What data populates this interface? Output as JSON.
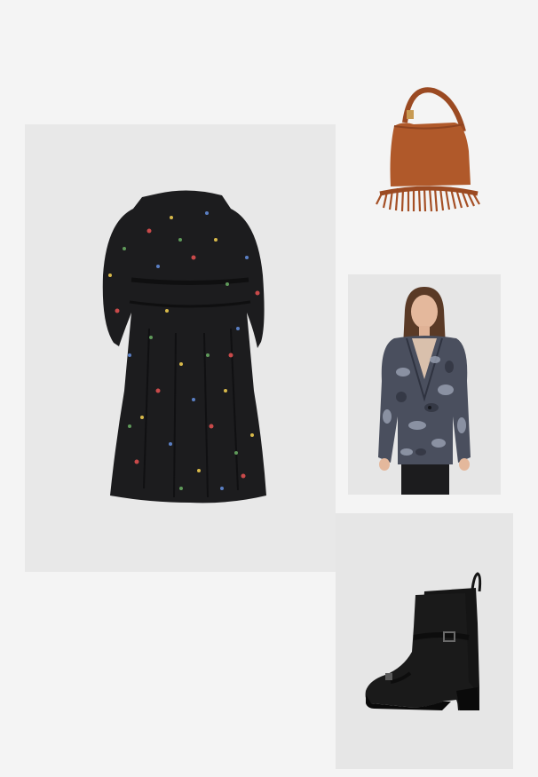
{
  "outfit": {
    "items": [
      {
        "name": "floral-print-dress",
        "image": "dress-image"
      },
      {
        "name": "fringe-suede-hobo-bag",
        "image": "bag-image"
      },
      {
        "name": "metallic-print-blazer",
        "image": "blazer-image"
      },
      {
        "name": "black-leather-ankle-boots",
        "image": "boots-image"
      }
    ],
    "colors": {
      "page_background": "#f4f4f4",
      "tile_background": "#e8e8e8",
      "dress_base": "#1c1c1e",
      "bag_suede": "#b0592a",
      "blazer_base": "#4a4f5e",
      "boots_leather": "#1a1a1a"
    }
  }
}
